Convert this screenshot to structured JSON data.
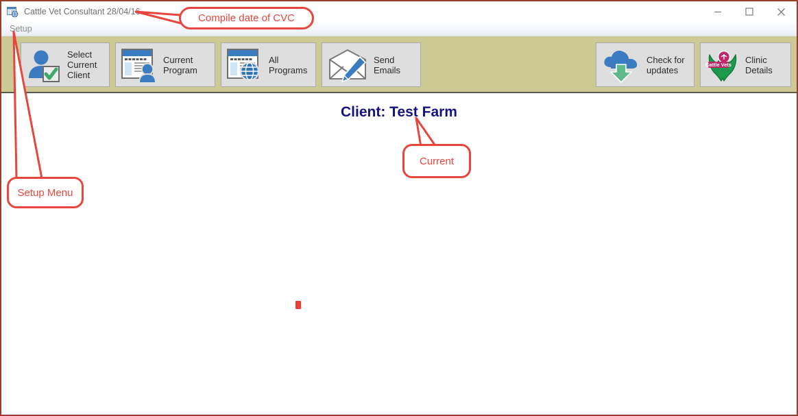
{
  "window": {
    "title": "Cattle Vet Consultant 28/04/16",
    "app_icon": "window-globe-icon",
    "border_color": "#9b3f2c",
    "controls": {
      "minimize": "minimize-icon",
      "maximize": "maximize-icon",
      "close": "close-icon"
    }
  },
  "menu": {
    "items": [
      {
        "label": "Setup",
        "name": "menu-item-setup"
      }
    ]
  },
  "toolbar": {
    "background_color": "#ccc995",
    "buttons": [
      {
        "id": "select-client",
        "label": "Select\nCurrent\nClient",
        "icon": "user-check-icon"
      },
      {
        "id": "current-program",
        "label": "Current\nProgram",
        "icon": "window-user-icon"
      },
      {
        "id": "all-programs",
        "label": "All\nPrograms",
        "icon": "window-globe-icon"
      },
      {
        "id": "send-emails",
        "label": "Send Emails",
        "icon": "envelope-pencil-icon"
      },
      {
        "id": "check-updates",
        "label": "Check for\nupdates",
        "icon": "cloud-download-icon"
      },
      {
        "id": "clinic-details",
        "label": "Clinic Details",
        "icon": "cattle-vets-logo-icon"
      }
    ]
  },
  "main": {
    "client_heading": "Client: Test Farm",
    "client_heading_color": "#131380",
    "marker": "red-dot-marker"
  },
  "annotations": {
    "accent_color": "#e8463c",
    "items": [
      {
        "id": "compile-date",
        "text": "Compile date of CVC",
        "points_to": "window-title-date"
      },
      {
        "id": "current",
        "text": "Current",
        "points_to": "client-heading"
      },
      {
        "id": "setup-menu",
        "text": "Setup Menu",
        "points_to": "menu-item-setup"
      }
    ]
  }
}
